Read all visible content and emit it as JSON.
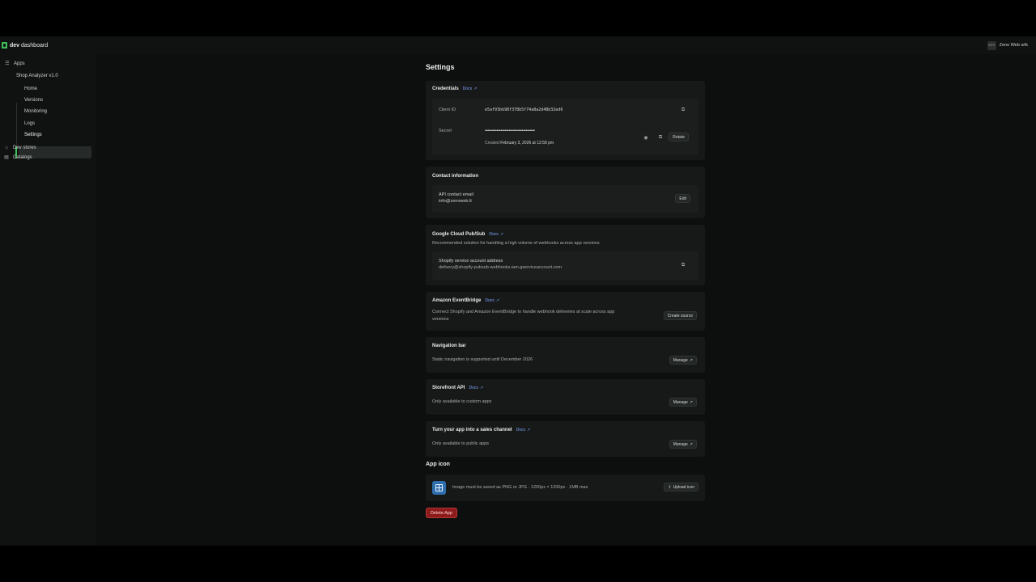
{
  "header": {
    "brand_bold": "dev",
    "brand_rest": " dashboard",
    "store_badge": "</>",
    "store_name": "Zeno Web srlk"
  },
  "sidebar": {
    "apps_label": "Apps",
    "app_name": "Shop Analyzer v1.0",
    "items": [
      {
        "label": "Home"
      },
      {
        "label": "Versions"
      },
      {
        "label": "Monitoring"
      },
      {
        "label": "Logs"
      },
      {
        "label": "Settings"
      }
    ],
    "dev_stores": "Dev stores",
    "catalogs": "Catalogs"
  },
  "page": {
    "title": "Settings"
  },
  "credentials": {
    "title": "Credentials",
    "docs": "Docs",
    "client_id_label": "Client ID",
    "client_id_value": "e5af93bb98f378b5f74a8a2d48b32ed6",
    "secret_label": "Secret",
    "secret_value": "••••••••••••••••••••••••••••••••••••••",
    "created_prefix": "Created",
    "created_date": "February 3, 2026 at 12:58 pm",
    "rotate": "Rotate"
  },
  "contact": {
    "title": "Contact information",
    "api_label": "API contact email",
    "api_value": "info@zenoweb.lt",
    "edit": "Edit"
  },
  "pubsub": {
    "title": "Google Cloud Pub/Sub",
    "docs": "Docs",
    "description": "Recommended solution for handling a high volume of webhooks across app versions",
    "service_label": "Shopify service account address",
    "service_value": "delivery@shopify-pubsub-webhooks.iam.gserviceaccount.com"
  },
  "eventbridge": {
    "title": "Amazon EventBridge",
    "docs": "Docs",
    "description_line1": "Connect Shopify and Amazon EventBridge to handle webhook deliveries at scale across app",
    "description_line2": "versions",
    "create": "Create source"
  },
  "navbar": {
    "title": "Navigation bar",
    "description": "Static navigation is supported until December 2026",
    "manage": "Manage"
  },
  "storefront": {
    "title": "Storefront API",
    "docs": "Docs",
    "description": "Only available to custom apps",
    "manage": "Manage"
  },
  "sales": {
    "title": "Turn your app into a sales channel",
    "docs": "Docs",
    "description": "Only available to public apps",
    "manage": "Manage"
  },
  "app_icon": {
    "title": "App icon",
    "hint": "Image must be saved as PNG or JPG · 1200px × 1200px · 1MB max",
    "upload": "Upload icon"
  },
  "delete": {
    "label": "Delete App"
  },
  "colors": {
    "accent": "#3fbf5a",
    "link": "#7fa7ff",
    "danger": "#8e1b1b"
  }
}
